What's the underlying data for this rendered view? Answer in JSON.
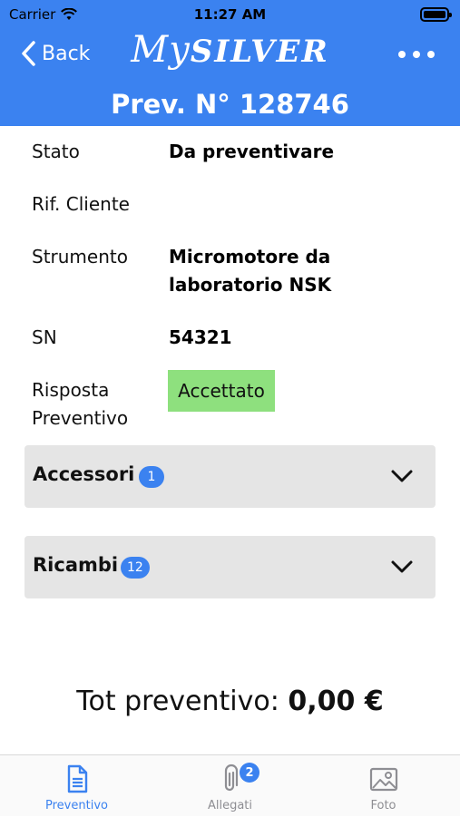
{
  "status_bar": {
    "carrier": "Carrier",
    "time": "11:27 AM"
  },
  "nav": {
    "back_label": "Back",
    "logo_part1": "My",
    "logo_part2": "SILVER",
    "title": "Prev. N° 128746"
  },
  "details": {
    "stato_label": "Stato",
    "stato_value": "Da preventivare",
    "rif_label": "Rif. Cliente",
    "rif_value": "",
    "strumento_label": "Strumento",
    "strumento_value_line1": "Micromotore da",
    "strumento_value_line2": "laboratorio NSK",
    "sn_label": "SN",
    "sn_value": "54321",
    "risposta_label_line1": "Risposta",
    "risposta_label_line2": "Preventivo",
    "risposta_value": "Accettato"
  },
  "sections": [
    {
      "title": "Accessori",
      "count": "1"
    },
    {
      "title": "Ricambi",
      "count": "12"
    }
  ],
  "total": {
    "label": "Tot preventivo:",
    "amount": "0,00 €"
  },
  "tabs": [
    {
      "label": "Preventivo",
      "icon": "document-icon",
      "active": true
    },
    {
      "label": "Allegati",
      "icon": "paperclip-icon",
      "badge": "2"
    },
    {
      "label": "Foto",
      "icon": "photo-icon"
    }
  ],
  "colors": {
    "accent": "#3b82f0",
    "accepted": "#8ee07e",
    "section_bg": "#e5e5e5"
  }
}
